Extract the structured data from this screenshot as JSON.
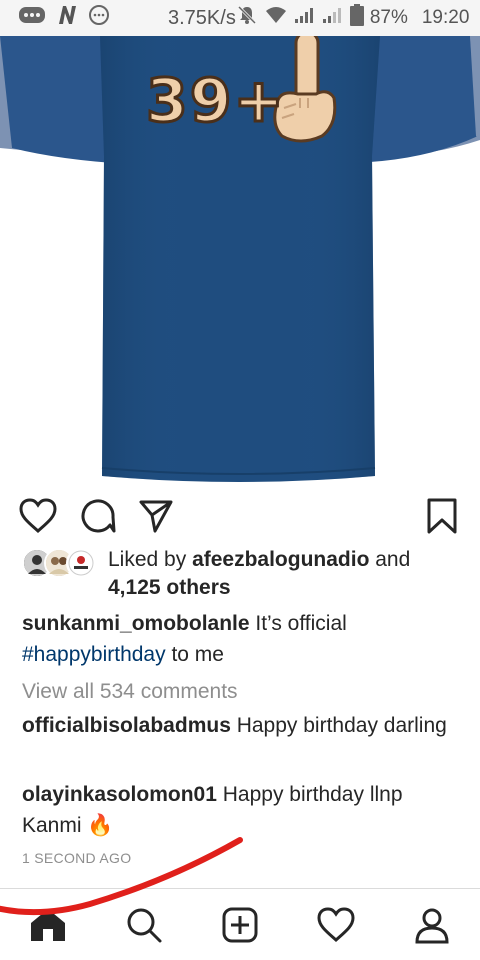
{
  "status_bar": {
    "network_speed": "3.75K/s",
    "battery_percent": "87%",
    "time": "19:20"
  },
  "post": {
    "image_text": "39+"
  },
  "likes": {
    "prefix": "Liked by ",
    "user": "afeezbalogunadio",
    "middle": " and",
    "others": "4,125 others"
  },
  "caption": {
    "username": "sunkanmi_omobolanle",
    "text_before": " It’s official",
    "hashtag": "#happybirthday",
    "text_after": " to me"
  },
  "view_all_comments": "View all 534 comments",
  "comments": [
    {
      "username": "officialbisolabadmus",
      "text": " Happy birthday darling"
    },
    {
      "username": "olayinkasolomon01",
      "text": " Happy birthday llnp Kanmi",
      "emoji": "🔥"
    }
  ],
  "timestamp": "1 SECOND AGO",
  "nav": {
    "items": [
      "home-icon",
      "search-icon",
      "add-post-icon",
      "activity-heart-icon",
      "profile-icon"
    ]
  },
  "colors": {
    "shirt": "#1f4d7f",
    "hashtag": "#00376b",
    "muted": "#8e8e8e",
    "annotation": "#e0201b"
  }
}
